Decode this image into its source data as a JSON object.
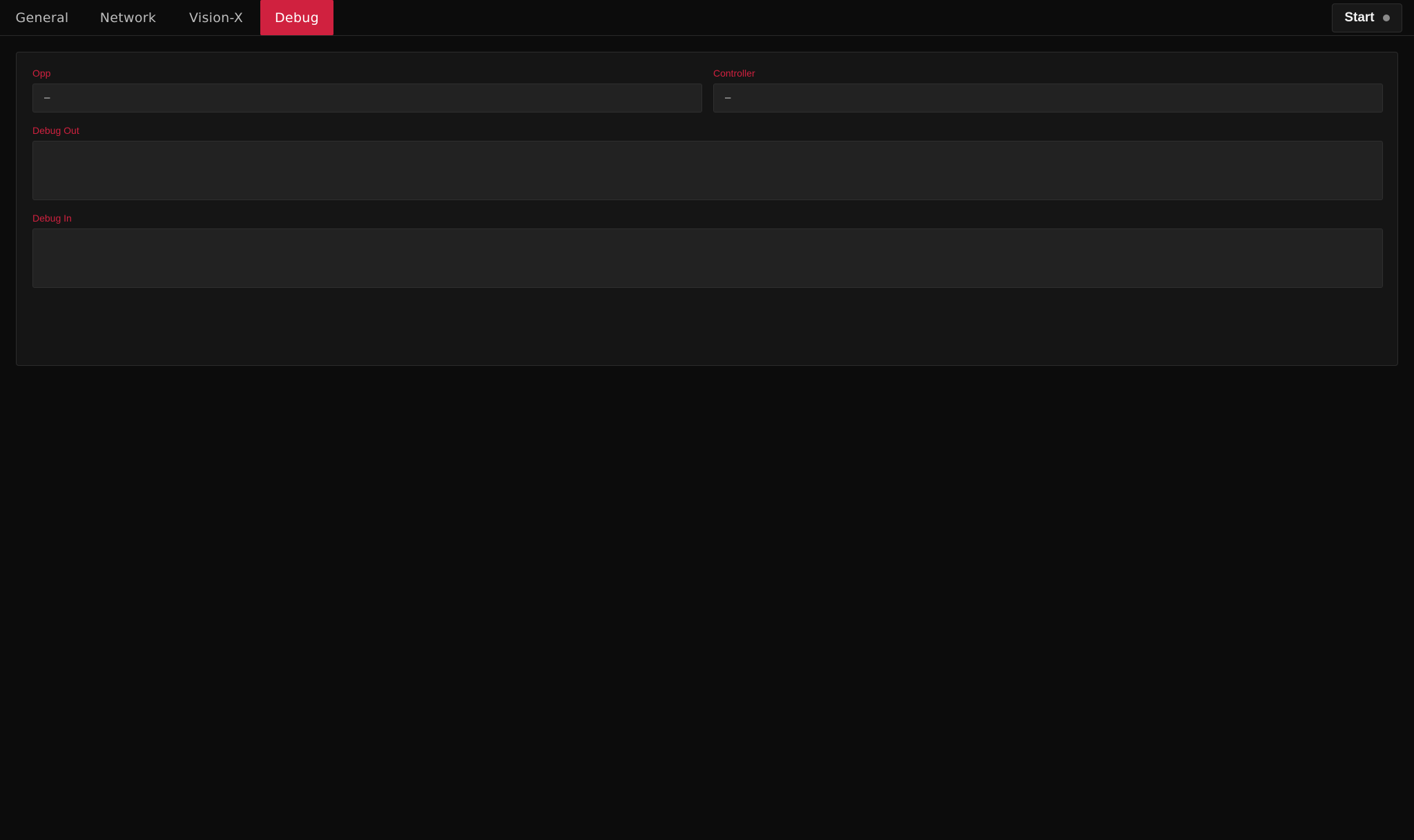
{
  "tabs": [
    {
      "label": "General",
      "active": false
    },
    {
      "label": "Network",
      "active": false
    },
    {
      "label": "Vision-X",
      "active": false
    },
    {
      "label": "Debug",
      "active": true
    }
  ],
  "start_button": {
    "label": "Start",
    "status_icon": "status-dot-icon"
  },
  "debug_panel": {
    "opp": {
      "label": "Opp",
      "value": "—"
    },
    "controller": {
      "label": "Controller",
      "value": "—"
    },
    "debug_out": {
      "label": "Debug Out",
      "value": ""
    },
    "debug_in": {
      "label": "Debug In",
      "value": ""
    }
  },
  "colors": {
    "accent": "#d0213f",
    "background": "#0c0c0c",
    "panel": "#151515",
    "field": "#222222",
    "status_dot": "#8a8a8a"
  }
}
